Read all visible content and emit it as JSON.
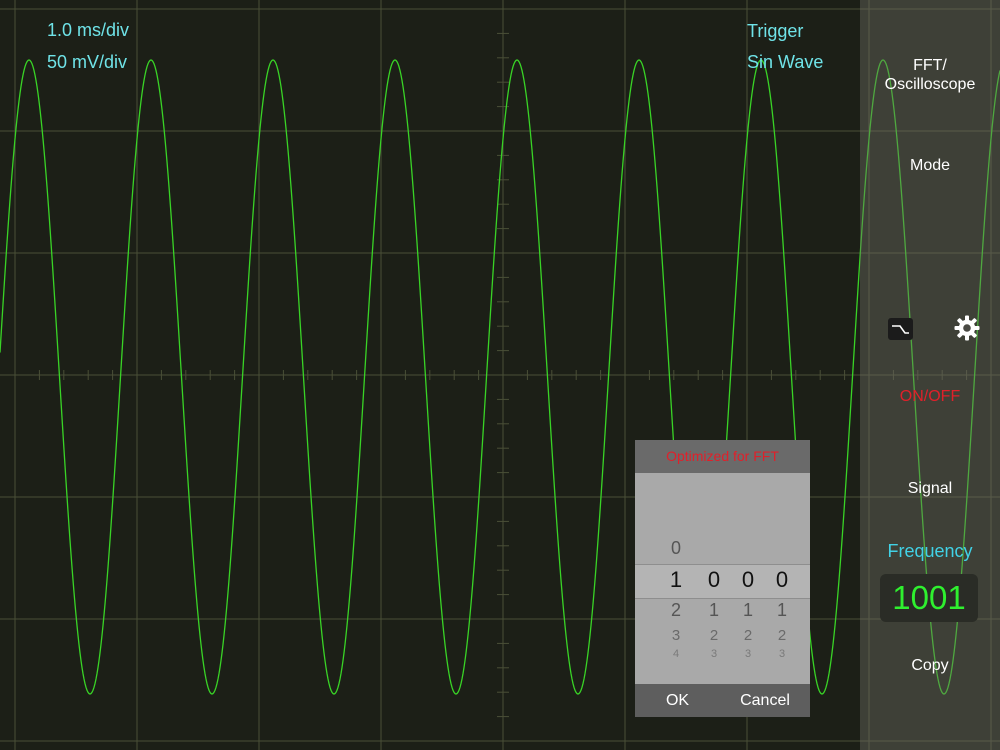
{
  "scope": {
    "time_div": "1.0 ms/div",
    "volt_div": "50 mV/div",
    "trigger_label": "Trigger",
    "trigger_source": "Sin Wave",
    "colors": {
      "background": "#1c1f17",
      "grid": "#4a4f37",
      "trace": "#39d326",
      "readout": "#6fe3e8"
    }
  },
  "panel": {
    "mode_toggle": "FFT/\nOscilloscope",
    "mode": "Mode",
    "filter_icon": "lowpass-filter-icon",
    "settings_icon": "gear-icon",
    "on_off": "ON/OFF",
    "signal": "Signal",
    "frequency_label": "Frequency",
    "frequency_value": "1001",
    "copy": "Copy"
  },
  "picker": {
    "title": "Optimized for FFT",
    "selected": [
      "1",
      "0",
      "0",
      "0"
    ],
    "above": [
      "0",
      "",
      "",
      ""
    ],
    "below1": [
      "2",
      "1",
      "1",
      "1"
    ],
    "below2": [
      "3",
      "2",
      "2",
      "2"
    ],
    "below3": [
      "4",
      "3",
      "3",
      "3"
    ],
    "ok": "OK",
    "cancel": "Cancel"
  }
}
